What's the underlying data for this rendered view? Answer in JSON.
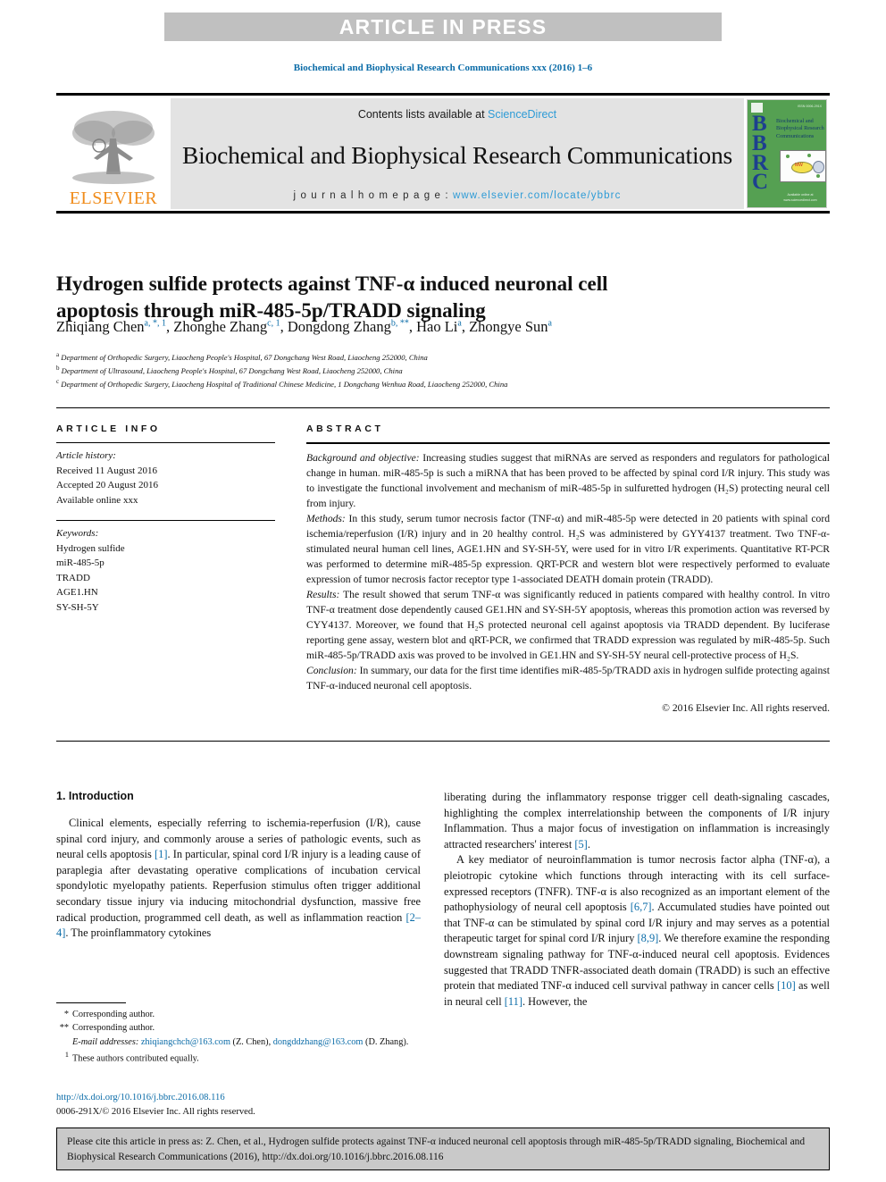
{
  "banner": {
    "label": "ARTICLE IN PRESS"
  },
  "running_head": "Biochemical and Biophysical Research Communications xxx (2016) 1–6",
  "masthead": {
    "contents_prefix": "Contents lists available at ",
    "sciencedirect": "ScienceDirect",
    "journal_title": "Biochemical and Biophysical Research Communications",
    "homepage_label": "j o u r n a l   h o m e p a g e :  ",
    "homepage_url": "www.elsevier.com/locate/ybbrc",
    "elsevier_wordmark": "ELSEVIER",
    "cover": {
      "letters": "BBRC",
      "title_lines": "Biochemical and Biophysical Research Communications",
      "top_right_note": "ISSN 0006-291X",
      "bottom_note": "Available online at www.sciencedirect.com"
    }
  },
  "article": {
    "title": "Hydrogen sulfide protects against TNF-α induced neuronal cell apoptosis through miR-485-5p/TRADD signaling",
    "authors": [
      {
        "name": "Zhiqiang Chen",
        "sup": "a, *, 1",
        "sep": ", "
      },
      {
        "name": "Zhonghe Zhang",
        "sup": "c, 1",
        "sep": ", "
      },
      {
        "name": "Dongdong Zhang",
        "sup": "b, **",
        "sep": ", "
      },
      {
        "name": "Hao Li",
        "sup": "a",
        "sep": ", "
      },
      {
        "name": "Zhongye Sun",
        "sup": "a",
        "sep": ""
      }
    ],
    "affiliations": [
      {
        "mark": "a",
        "text": "Department of Orthopedic Surgery, Liaocheng People's Hospital, 67 Dongchang West Road, Liaocheng 252000, China"
      },
      {
        "mark": "b",
        "text": "Department of Ultrasound, Liaocheng People's Hospital, 67 Dongchang West Road, Liaocheng 252000, China"
      },
      {
        "mark": "c",
        "text": "Department of Orthopedic Surgery, Liaocheng Hospital of Traditional Chinese Medicine, 1 Dongchang Wenhua Road, Liaocheng 252000, China"
      }
    ]
  },
  "article_info": {
    "heading": "ARTICLE INFO",
    "history_label": "Article history:",
    "history": [
      "Received 11 August 2016",
      "Accepted 20 August 2016",
      "Available online xxx"
    ],
    "keywords_label": "Keywords:",
    "keywords": [
      "Hydrogen sulfide",
      "miR-485-5p",
      "TRADD",
      "AGE1.HN",
      "SY-SH-5Y"
    ]
  },
  "abstract": {
    "heading": "ABSTRACT",
    "paragraphs": [
      {
        "lead": "Background and objective:",
        "text": " Increasing studies suggest that miRNAs are served as responders and regulators for pathological change in human. miR-485-5p is such a miRNA that has been proved to be affected by spinal cord I/R injury. This study was to investigate the functional involvement and mechanism of miR-485-5p in sulfuretted hydrogen (H₂S) protecting neural cell from injury."
      },
      {
        "lead": "Methods:",
        "text": " In this study, serum tumor necrosis factor (TNF-α) and miR-485-5p were detected in 20 patients with spinal cord ischemia/reperfusion (I/R) injury and in 20 healthy control. H₂S was administered by GYY4137 treatment. Two TNF-α-stimulated neural human cell lines, AGE1.HN and SY-SH-5Y, were used for in vitro I/R experiments. Quantitative RT-PCR was performed to determine miR-485-5p expression. QRT-PCR and western blot were respectively performed to evaluate expression of tumor necrosis factor receptor type 1-associated DEATH domain protein (TRADD)."
      },
      {
        "lead": "Results:",
        "text": " The result showed that serum TNF-α was significantly reduced in patients compared with healthy control. In vitro TNF-α treatment dose dependently caused GE1.HN and SY-SH-5Y apoptosis, whereas this promotion action was reversed by CYY4137. Moreover, we found that H₂S protected neuronal cell against apoptosis via TRADD dependent. By luciferase reporting gene assay, western blot and qRT-PCR, we confirmed that TRADD expression was regulated by miR-485-5p. Such miR-485-5p/TRADD axis was proved to be involved in GE1.HN and SY-SH-5Y neural cell-protective process of H₂S."
      },
      {
        "lead": "Conclusion:",
        "text": " In summary, our data for the first time identifies miR-485-5p/TRADD axis in hydrogen sulfide protecting against TNF-α-induced neuronal cell apoptosis."
      }
    ],
    "copyright": "© 2016 Elsevier Inc. All rights reserved."
  },
  "introduction": {
    "heading": "1. Introduction",
    "left_paragraphs": [
      "Clinical elements, especially referring to ischemia-reperfusion (I/R), cause spinal cord injury, and commonly arouse a series of pathologic events, such as neural cells apoptosis [1]. In particular, spinal cord I/R injury is a leading cause of paraplegia after devastating operative complications of incubation cervical spondylotic myelopathy patients. Reperfusion stimulus often trigger additional secondary tissue injury via inducing mitochondrial dysfunction, massive free radical production, programmed cell death, as well as inflammation reaction [2–4]. The proinflammatory cytokines"
    ],
    "right_paragraphs": [
      "liberating during the inflammatory response trigger cell death-signaling cascades, highlighting the complex interrelationship between the components of I/R injury Inflammation. Thus a major focus of investigation on inflammation is increasingly attracted researchers' interest [5].",
      "A key mediator of neuroinflammation is tumor necrosis factor alpha (TNF-α), a pleiotropic cytokine which functions through interacting with its cell surface-expressed receptors (TNFR). TNF-α is also recognized as an important element of the pathophysiology of neural cell apoptosis [6,7]. Accumulated studies have pointed out that TNF-α can be stimulated by spinal cord I/R injury and may serves as a potential therapeutic target for spinal cord I/R injury [8,9]. We therefore examine the responding downstream signaling pathway for TNF-α-induced neural cell apoptosis. Evidences suggested that TRADD TNFR-associated death domain (TRADD) is such an effective protein that mediated TNF-α induced cell survival pathway in cancer cells [10] as well in neural cell [11]. However, the"
    ]
  },
  "footnotes": {
    "corresponding_1_mark": "*",
    "corresponding_1": "Corresponding author.",
    "corresponding_2_mark": "**",
    "corresponding_2": "Corresponding author.",
    "email_label": "E-mail addresses:",
    "email_1": "zhiqiangchch@163.com",
    "email_1_owner": "(Z. Chen),",
    "email_2": "dongddzhang@163.com",
    "email_2_owner": "(D. Zhang).",
    "equal_mark": "1",
    "equal_contrib": "These authors contributed equally."
  },
  "doi_block": {
    "doi_url": "http://dx.doi.org/10.1016/j.bbrc.2016.08.116",
    "issn_line": "0006-291X/© 2016 Elsevier Inc. All rights reserved."
  },
  "citation_box": {
    "text": "Please cite this article in press as: Z. Chen, et al., Hydrogen sulfide protects against TNF-α induced neuronal cell apoptosis through miR-485-5p/TRADD signaling, Biochemical and Biophysical Research Communications (2016), http://dx.doi.org/10.1016/j.bbrc.2016.08.116"
  },
  "colors": {
    "link_blue": "#0b6ca8",
    "sciencedirect_blue": "#2e9bd6",
    "elsevier_orange": "#f08c1b",
    "banner_gray": "#c0c0c0",
    "masthead_gray": "#e3e3e3",
    "cover_green": "#55a052",
    "cover_letter_blue": "#1d3f8f",
    "cite_box_gray": "#c9c9c9"
  }
}
